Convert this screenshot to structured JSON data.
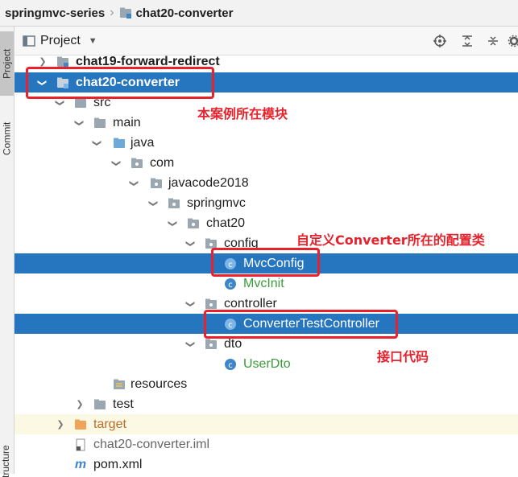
{
  "breadcrumb": {
    "root": "springmvc-series",
    "module": "chat20-converter"
  },
  "left_strip": {
    "project_tab": "Project",
    "commit_tab": "Commit",
    "structure_tab": "Structure"
  },
  "project_panel": {
    "title": "Project"
  },
  "tree": {
    "chat19": "chat19-forward-redirect",
    "chat20": "chat20-converter",
    "src": "src",
    "main": "main",
    "java": "java",
    "com": "com",
    "javacode2018": "javacode2018",
    "springmvc": "springmvc",
    "chat20_pkg": "chat20",
    "config": "config",
    "mvcconfig": "MvcConfig",
    "mvcinit": "MvcInit",
    "controller": "controller",
    "convertertestcontroller": "ConverterTestController",
    "dto": "dto",
    "userdto": "UserDto",
    "resources": "resources",
    "test": "test",
    "target": "target",
    "iml": "chat20-converter.iml",
    "pom": "pom.xml"
  },
  "annotations": {
    "module_note": "本案例所在模块",
    "config_note": "自定义Converter所在的配置类",
    "controller_note": "接口代码"
  },
  "colors": {
    "selection": "#2675bf",
    "annotation": "#e8222c",
    "folder": "#9aa7b0",
    "source_folder": "#6ea9d8",
    "class_icon": "#3e86c9",
    "target_folder": "#f0a35b"
  }
}
